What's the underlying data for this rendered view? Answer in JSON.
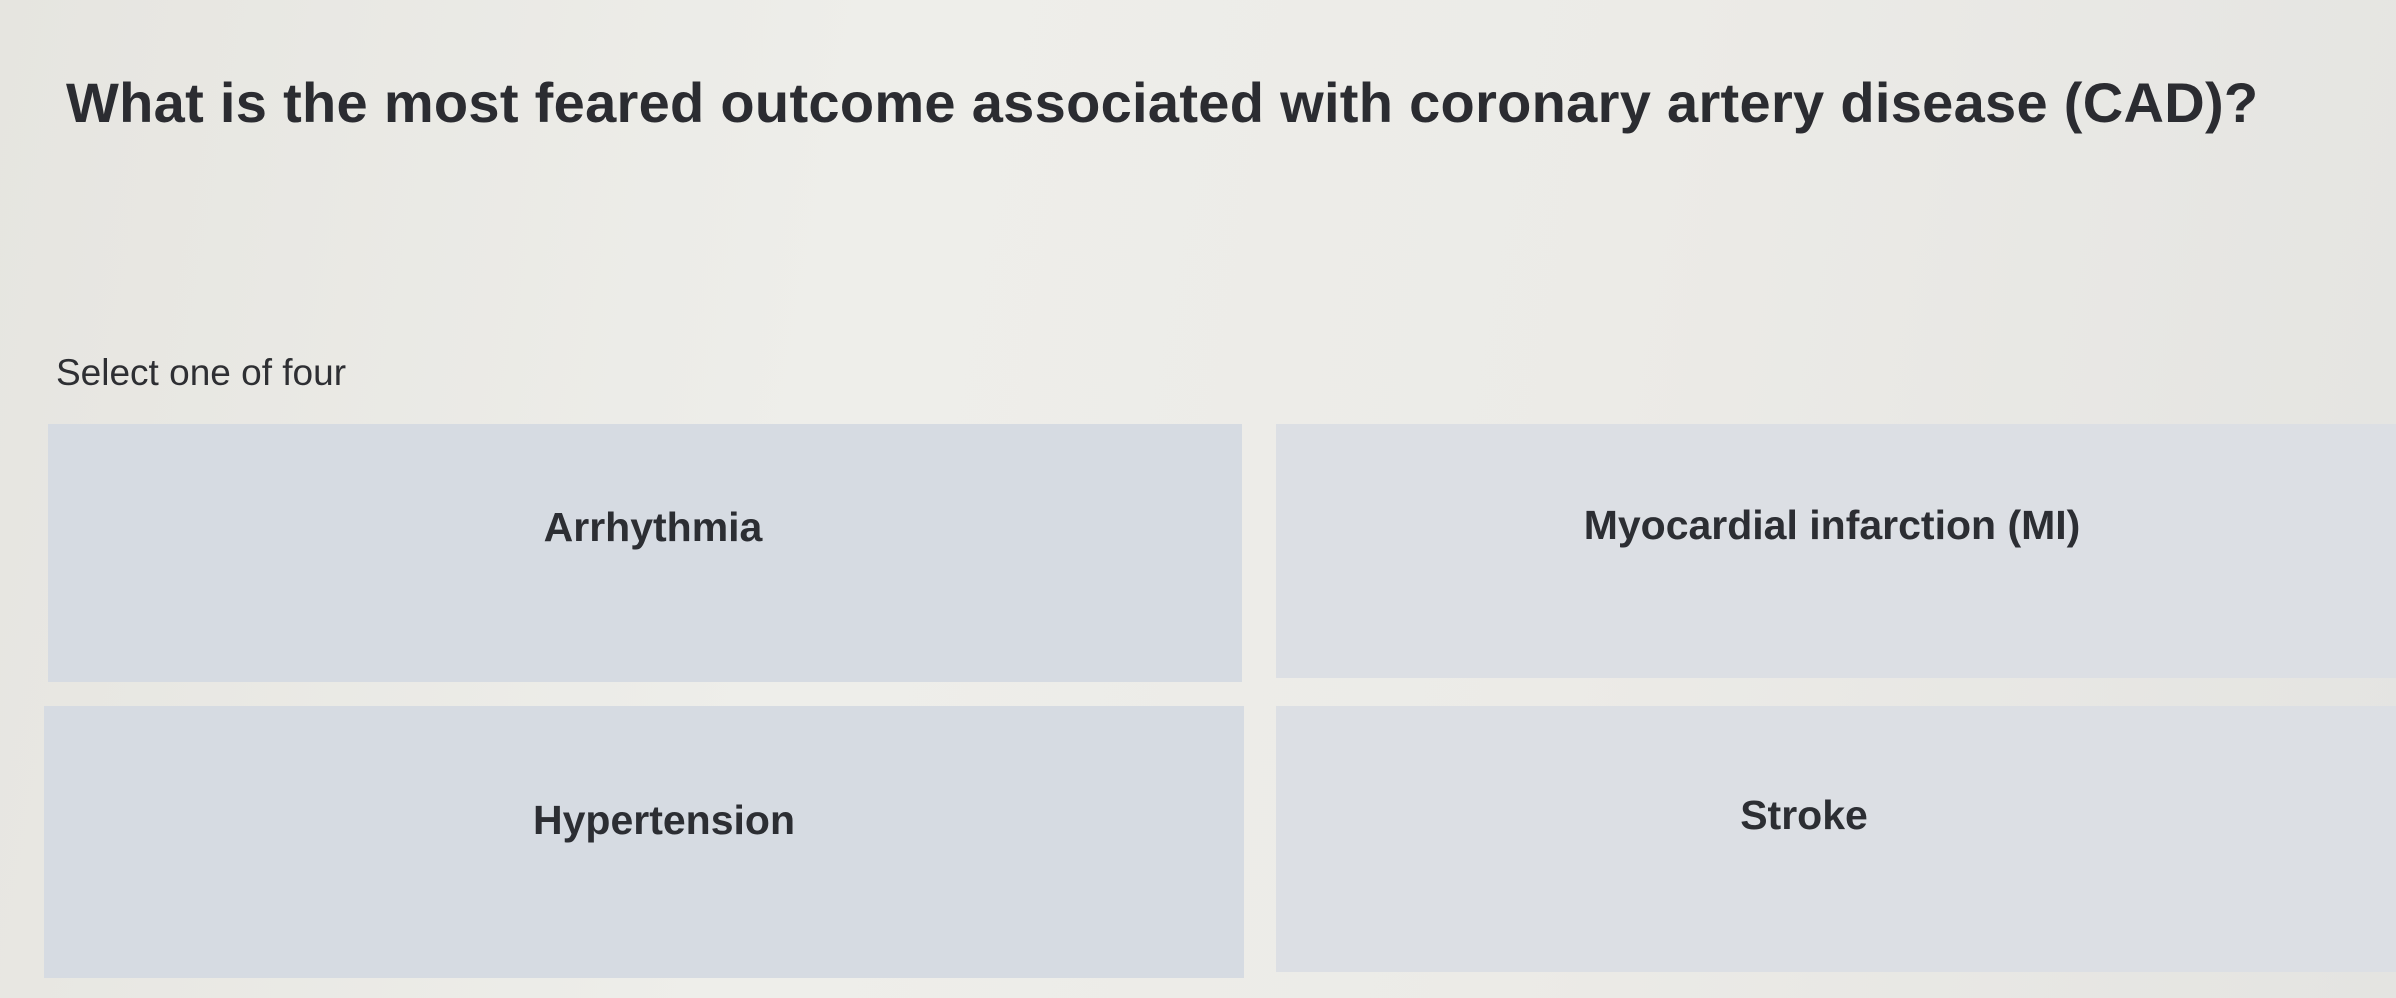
{
  "question": {
    "text": "What is the most feared outcome associated with coronary artery disease (CAD)?"
  },
  "instruction": "Select one of four",
  "options": [
    {
      "label": "Arrhythmia"
    },
    {
      "label": "Myocardial infarction (MI)"
    },
    {
      "label": "Hypertension"
    },
    {
      "label": "Stroke"
    }
  ],
  "colors": {
    "background": "#ebeae6",
    "option_background": "#d6dbe2",
    "text": "#2b2c31"
  }
}
